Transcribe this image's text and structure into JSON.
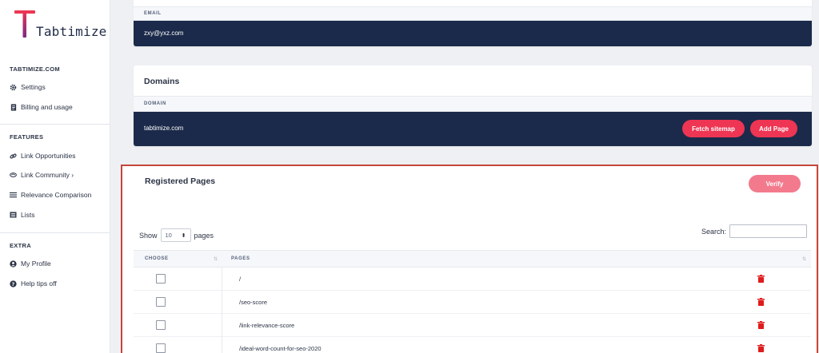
{
  "brand": {
    "name": "Tabtimize",
    "accent": "#ee3553",
    "navy": "#1b2a4a"
  },
  "sidebar": {
    "account_heading": "TABTIMIZE.COM",
    "account_items": [
      {
        "label": "Settings",
        "icon": "gear-icon"
      },
      {
        "label": "Billing and usage",
        "icon": "document-icon"
      }
    ],
    "features_heading": "FEATURES",
    "features_items": [
      {
        "label": "Link Opportunities",
        "icon": "link-icon"
      },
      {
        "label": "Link Community ›",
        "icon": "handshake-icon"
      },
      {
        "label": "Relevance Comparison",
        "icon": "bars-icon"
      },
      {
        "label": "Lists",
        "icon": "list-icon"
      }
    ],
    "extra_heading": "EXTRA",
    "extra_items": [
      {
        "label": "My Profile",
        "icon": "user-icon"
      },
      {
        "label": "Help tips off",
        "icon": "question-icon"
      }
    ]
  },
  "email_card": {
    "column_header": "EMAIL",
    "value": "zxy@yxz.com"
  },
  "domains_card": {
    "title": "Domains",
    "column_header": "DOMAIN",
    "value": "tabtimize.com",
    "fetch_label": "Fetch sitemap",
    "add_label": "Add Page"
  },
  "registered": {
    "title": "Registered Pages",
    "verify_label": "Verify",
    "show_label": "Show",
    "show_value": "10",
    "pages_label": "pages",
    "search_label": "Search:",
    "search_value": "",
    "columns": [
      "CHOOSE",
      "PAGES"
    ],
    "rows": [
      "/",
      "/seo-score",
      "/link-relevance-score",
      "/ideal-word-count-for-seo-2020"
    ]
  }
}
